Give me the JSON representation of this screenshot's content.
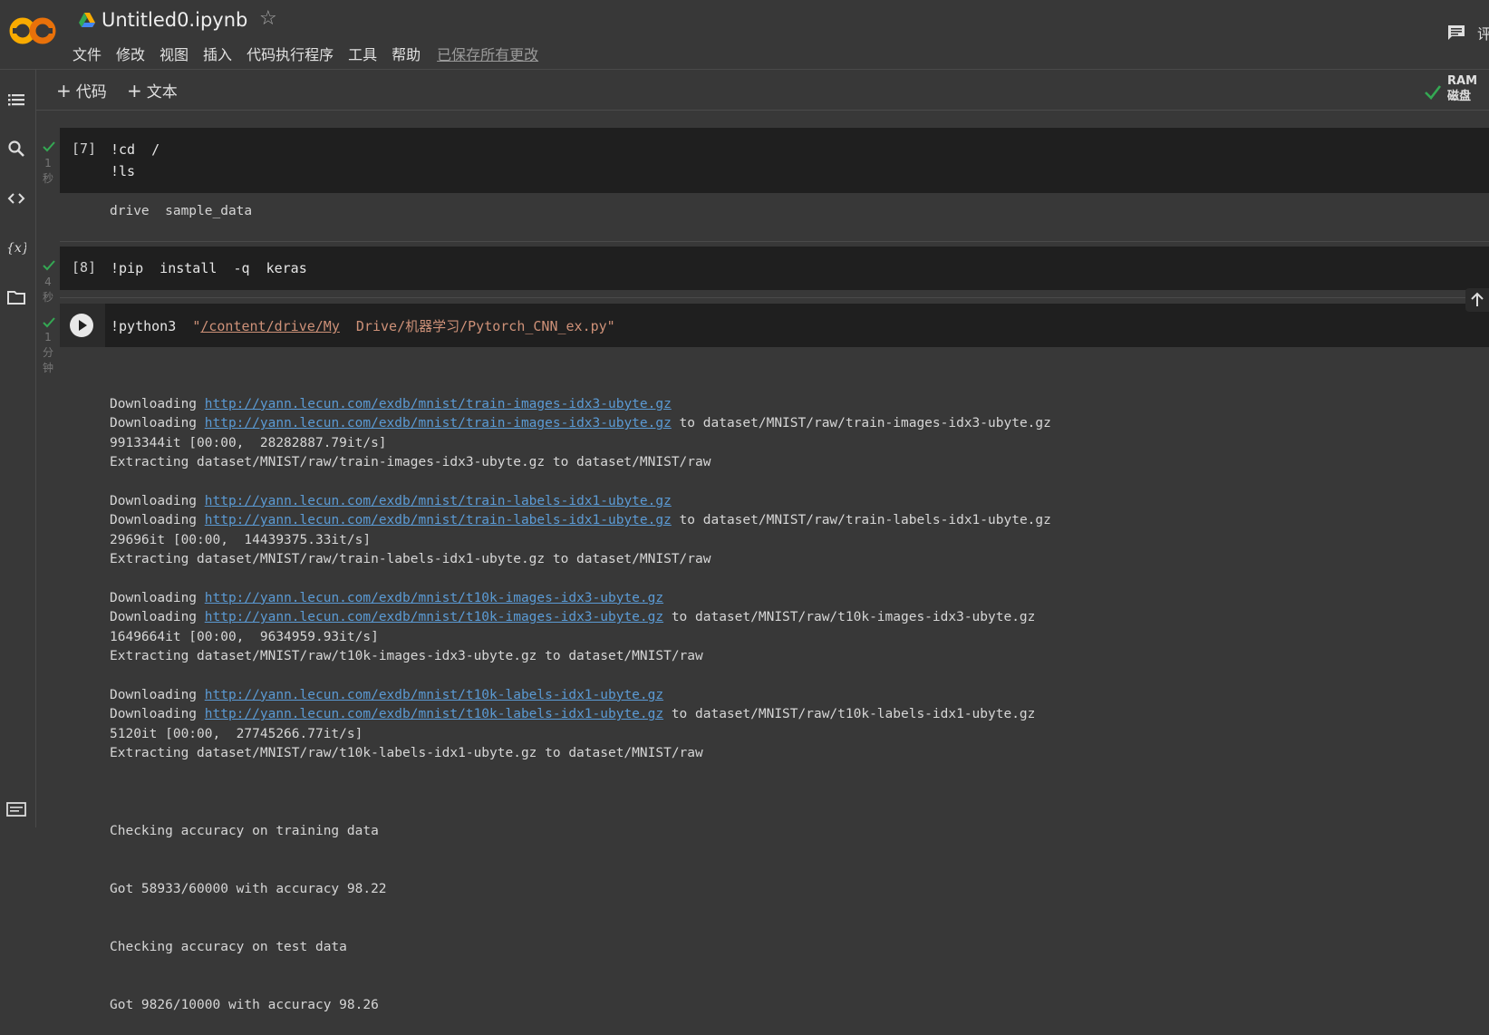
{
  "header": {
    "title": "Untitled0.ipynb",
    "menu": [
      "文件",
      "修改",
      "视图",
      "插入",
      "代码执行程序",
      "工具",
      "帮助"
    ],
    "saved_status": "已保存所有更改",
    "cut_text": "评"
  },
  "toolbar": {
    "add_code_label": "代码",
    "add_text_label": "文本",
    "ram_label": "RAM",
    "disk_label": "磁盘"
  },
  "cells": [
    {
      "exec_count": "[7]",
      "time_lines": [
        "1",
        "秒"
      ],
      "code": [
        "!cd  /",
        "!ls"
      ],
      "output": "drive  sample_data"
    },
    {
      "exec_count": "[8]",
      "time_lines": [
        "4",
        "秒"
      ],
      "code": [
        "!pip  install  -q  keras"
      ]
    },
    {
      "time_lines": [
        "1",
        "分",
        "钟"
      ],
      "code_prefix": "!python3  ",
      "code_quote_open": "\"",
      "code_path_link": "/content/drive/My",
      "code_path_rest": "  Drive/机器学习/Pytorch_CNN_ex.py\"",
      "output": {
        "downloading": "Downloading ",
        "to": " to ",
        "extracting": "Extracting ",
        "blocks": [
          {
            "url": "http://yann.lecun.com/exdb/mnist/train-images-idx3-ubyte.gz",
            "dest": "dataset/MNIST/raw/train-images-idx3-ubyte.gz",
            "progress": "9913344it [00:00,  28282887.79it/s]",
            "extract": "dataset/MNIST/raw/train-images-idx3-ubyte.gz to dataset/MNIST/raw"
          },
          {
            "url": "http://yann.lecun.com/exdb/mnist/train-labels-idx1-ubyte.gz",
            "dest": "dataset/MNIST/raw/train-labels-idx1-ubyte.gz",
            "progress": "29696it [00:00,  14439375.33it/s]",
            "extract": "dataset/MNIST/raw/train-labels-idx1-ubyte.gz to dataset/MNIST/raw"
          },
          {
            "url": "http://yann.lecun.com/exdb/mnist/t10k-images-idx3-ubyte.gz",
            "dest": "dataset/MNIST/raw/t10k-images-idx3-ubyte.gz",
            "progress": "1649664it [00:00,  9634959.93it/s]",
            "extract": "dataset/MNIST/raw/t10k-images-idx3-ubyte.gz to dataset/MNIST/raw"
          },
          {
            "url": "http://yann.lecun.com/exdb/mnist/t10k-labels-idx1-ubyte.gz",
            "dest": "dataset/MNIST/raw/t10k-labels-idx1-ubyte.gz",
            "progress": "5120it [00:00,  27745266.77it/s]",
            "extract": "dataset/MNIST/raw/t10k-labels-idx1-ubyte.gz to dataset/MNIST/raw"
          }
        ],
        "results": [
          "Checking accuracy on training data",
          "Got 58933/60000 with accuracy 98.22",
          "Checking accuracy on test data",
          "Got 9826/10000 with accuracy 98.26"
        ]
      }
    }
  ],
  "colors": {
    "background": "#383838",
    "code_bg": "#1f1f1f",
    "link": "#5b9bd5",
    "string": "#ce9178",
    "check": "#34a853",
    "logo_orange": "#f9ab00",
    "logo_dark_orange": "#e8710a"
  },
  "icons": {
    "logo": "colab-logo-icon",
    "drive": "drive-icon",
    "star": "star-icon",
    "comment": "comment-icon",
    "toc": "table-of-contents-icon",
    "search": "search-icon",
    "code": "code-snippets-icon",
    "variables": "variables-icon",
    "files": "folder-icon",
    "terminal": "terminal-icon",
    "run": "run-icon",
    "check": "check-icon",
    "scroll_up": "arrow-up-icon"
  }
}
